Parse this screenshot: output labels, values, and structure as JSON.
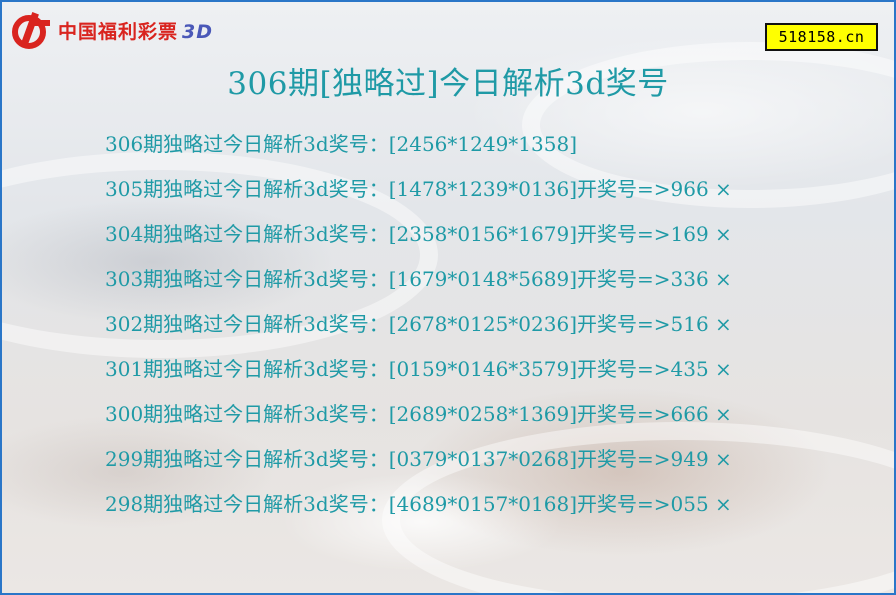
{
  "logo": {
    "text": "中国福利彩票",
    "suffix": "3D"
  },
  "site": "518158.cn",
  "title": "306期[独略过]今日解析3d奖号",
  "rows": [
    {
      "text": "306期独略过今日解析3d奖号：[2456*1249*1358]"
    },
    {
      "text": "305期独略过今日解析3d奖号：[1478*1239*0136]开奖号=>966 ×"
    },
    {
      "text": "304期独略过今日解析3d奖号：[2358*0156*1679]开奖号=>169 ×"
    },
    {
      "text": "303期独略过今日解析3d奖号：[1679*0148*5689]开奖号=>336 ×"
    },
    {
      "text": "302期独略过今日解析3d奖号：[2678*0125*0236]开奖号=>516 ×"
    },
    {
      "text": "301期独略过今日解析3d奖号：[0159*0146*3579]开奖号=>435 ×"
    },
    {
      "text": "300期独略过今日解析3d奖号：[2689*0258*1369]开奖号=>666 ×"
    },
    {
      "text": "299期独略过今日解析3d奖号：[0379*0137*0268]开奖号=>949 ×"
    },
    {
      "text": "298期独略过今日解析3d奖号：[4689*0157*0168]开奖号=>055 ×"
    }
  ]
}
